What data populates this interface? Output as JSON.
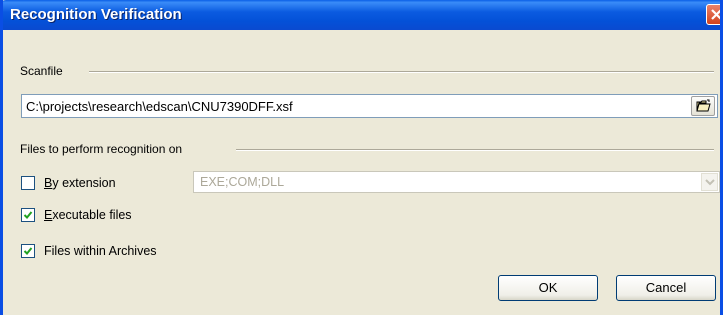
{
  "window": {
    "title": "Recognition Verification"
  },
  "scanfile": {
    "group_label": "Scanfile",
    "path_value": "C:\\projects\\research\\edscan\\CNU7390DFF.xsf",
    "browse_icon": "open-folder-icon"
  },
  "recognition": {
    "group_label": "Files to perform recognition on",
    "by_extension": {
      "label": "By extension",
      "mnemonic": "B",
      "rest": "y extension",
      "checked": false
    },
    "extensions_value": "EXE;COM;DLL",
    "executable_files": {
      "label": "Executable files",
      "mnemonic": "E",
      "rest": "xecutable files",
      "checked": true
    },
    "files_within_archives": {
      "label": "Files within Archives",
      "checked": true
    }
  },
  "buttons": {
    "ok": "OK",
    "cancel": "Cancel"
  },
  "colors": {
    "title_bar": "#0a5fe6",
    "close_button": "#d3431d",
    "dialog_bg": "#ece9d8"
  }
}
